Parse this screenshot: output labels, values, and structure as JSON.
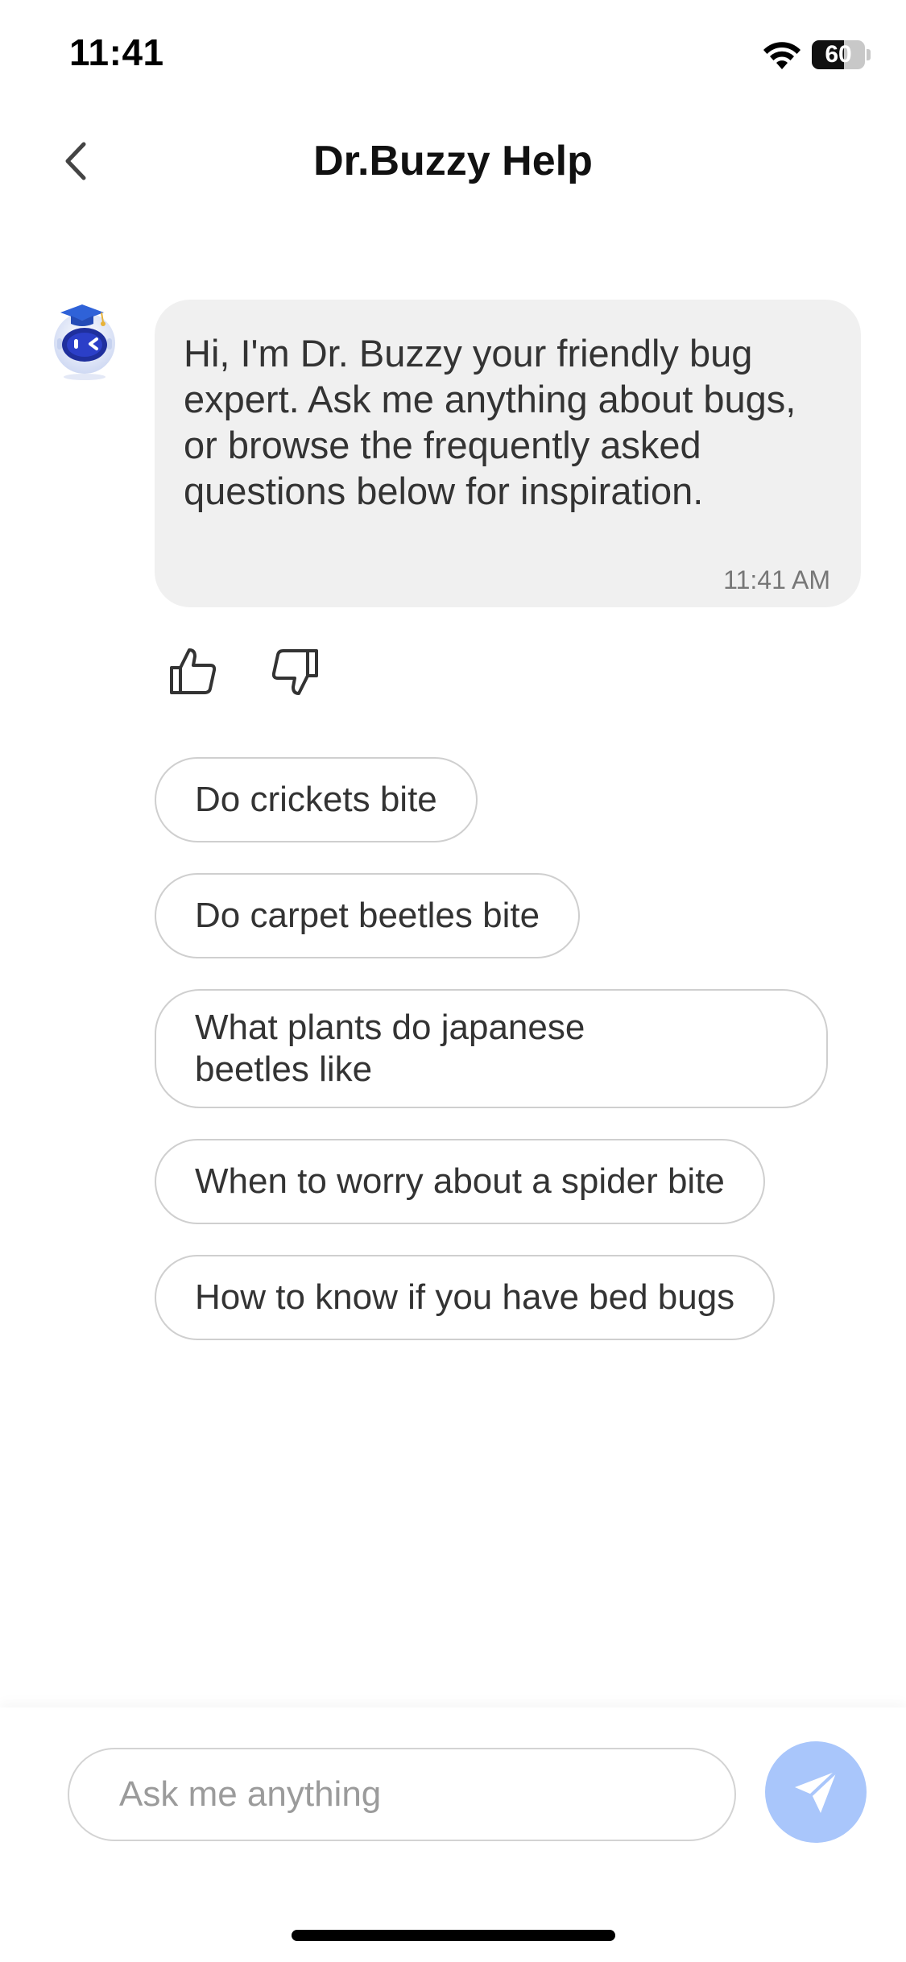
{
  "status_bar": {
    "time": "11:41",
    "battery_percent": "60",
    "battery_level": 0.6,
    "icons": [
      "wifi-icon",
      "battery-icon"
    ]
  },
  "nav": {
    "title": "Dr.Buzzy Help",
    "back_icon": "chevron-left-icon"
  },
  "chat": {
    "bot_message": "Hi, I'm Dr. Buzzy your friendly bug expert. Ask me anything about bugs, or browse the frequently asked questions below for inspiration.",
    "timestamp": "11:41 AM",
    "feedback_icons": [
      "thumbs-up-icon",
      "thumbs-down-icon"
    ]
  },
  "suggestions": [
    "Do crickets bite",
    "Do carpet beetles bite",
    "What plants do japanese beetles like",
    "When to worry about a spider bite",
    "How to know if you have bed bugs"
  ],
  "composer": {
    "placeholder": "Ask me anything",
    "value": "",
    "send_icon": "send-icon"
  },
  "colors": {
    "bubble_bg": "#f0f0f0",
    "chip_border": "#cfcfcf",
    "send_button": "#a9c6fb",
    "avatar_blue": "#2f55d4"
  }
}
